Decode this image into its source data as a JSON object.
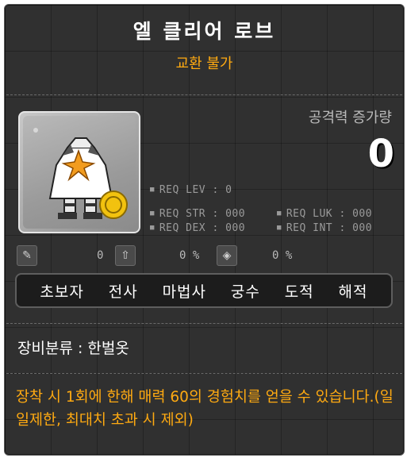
{
  "item": {
    "name": "엘 클리어 로브",
    "trade": "교환 불가"
  },
  "attack": {
    "label": "공격력 증가량",
    "value": "0"
  },
  "requirements": {
    "lev": "REQ LEV :     0",
    "str": "REQ STR : 000",
    "dex": "REQ DEX : 000",
    "luk": "REQ LUK : 000",
    "int": "REQ INT : 000"
  },
  "stats_row": {
    "v1": "0",
    "v2": "0 %",
    "v3": "0 %"
  },
  "jobs": [
    "초보자",
    "전사",
    "마법사",
    "궁수",
    "도적",
    "해적"
  ],
  "category": "장비분류 : 한벌옷",
  "description": "장착 시 1회에 한해 매력 60의 경험치를 얻을 수 있습니다.(일일제한, 최대치 초과 시 제외)",
  "colors": {
    "accent": "#ffaa11",
    "background": "#303030"
  }
}
